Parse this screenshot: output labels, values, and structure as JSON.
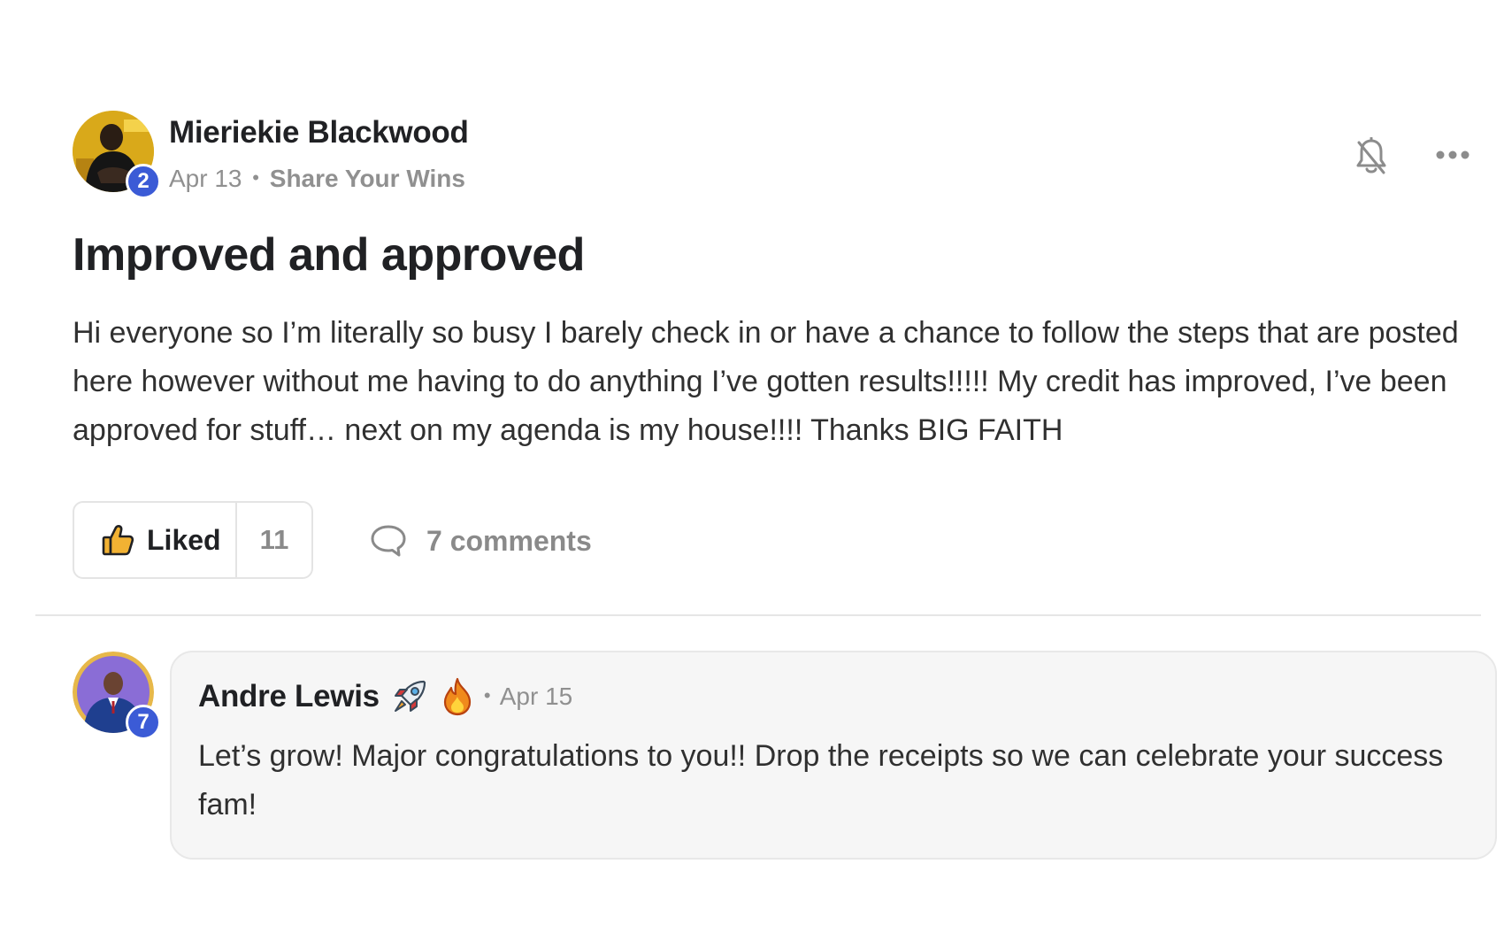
{
  "post": {
    "author": {
      "name": "Mieriekie Blackwood",
      "level": "2"
    },
    "date": "Apr 13",
    "separator": "•",
    "category": "Share Your Wins",
    "title": "Improved and approved",
    "body": "Hi everyone so I’m literally so busy I barely check in or have a chance to follow the steps that are posted here however without me having to do anything I’ve gotten results!!!!! My credit has improved, I’ve been approved for stuff… next on my agenda is my house!!!! Thanks BIG FAITH",
    "actions": {
      "like_label": "Liked",
      "like_count": "11",
      "comments_label": "7 comments"
    },
    "icons": {
      "notify": "bell-off-icon",
      "more": "more-horizontal-icon",
      "like": "thumbs-up-icon",
      "comment": "speech-bubble-icon"
    }
  },
  "comment": {
    "author": {
      "name": "Andre Lewis",
      "level": "7",
      "emojis": [
        "rocket-emoji",
        "fire-emoji"
      ]
    },
    "separator": "•",
    "date": "Apr 15",
    "text": "Let’s grow! Major congratulations to you!! Drop the receipts so we can celebrate your success fam!"
  },
  "colors": {
    "level_badge": "#3b5bd6",
    "comment_bg": "#f6f6f6",
    "muted_text": "#909090",
    "avatar_ring_gold": "#e0b21c"
  }
}
